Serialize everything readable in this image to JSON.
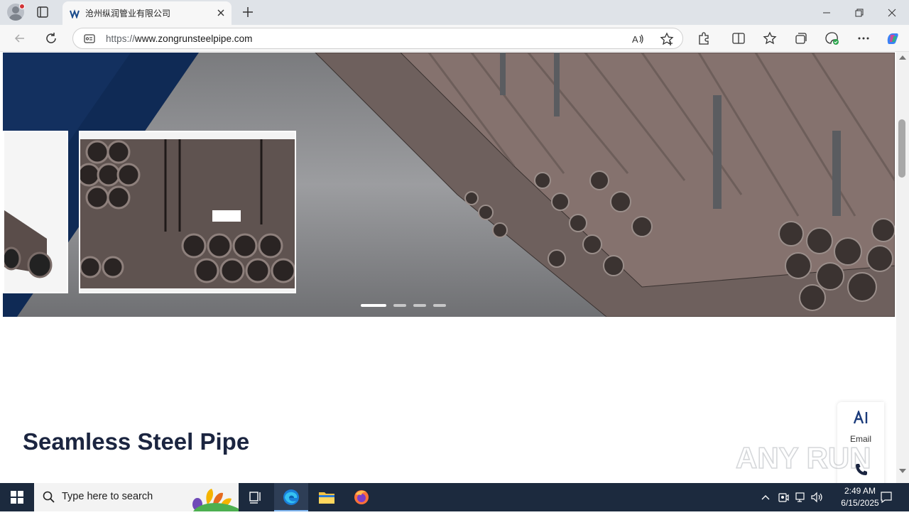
{
  "browser": {
    "tab_title": "沧州纵润管业有限公司",
    "url_scheme": "https://",
    "url_host": "www.zongrunsteelpipe.com"
  },
  "page": {
    "section_title": "Seamless Steel Pipe",
    "float_email_label": "Email",
    "carousel": {
      "slides": 4,
      "active_slide": 1
    }
  },
  "watermark": {
    "text": "ANY RUN"
  },
  "taskbar": {
    "search_placeholder": "Type here to search",
    "time": "2:49 AM",
    "date": "6/15/2025"
  },
  "colors": {
    "accent": "#0f2a55",
    "title_text": "#1b2540",
    "taskbar": "#1c2a3e"
  },
  "icons": [
    "profile-icon",
    "tab-actions-icon",
    "edge-favicon",
    "close-icon",
    "plus-icon",
    "minimize-icon",
    "restore-icon",
    "back-icon",
    "refresh-icon",
    "site-info-icon",
    "read-aloud-icon",
    "favorite-add-icon",
    "extensions-icon",
    "split-screen-icon",
    "favorites-icon",
    "collections-icon",
    "browser-essentials-icon",
    "more-icon",
    "copilot-icon",
    "ai-icon",
    "phone-icon",
    "windows-start-icon",
    "search-icon",
    "task-view-icon",
    "edge-icon",
    "file-explorer-icon",
    "firefox-icon",
    "chevron-up-icon",
    "network-icon",
    "volume-icon",
    "notification-icon"
  ]
}
